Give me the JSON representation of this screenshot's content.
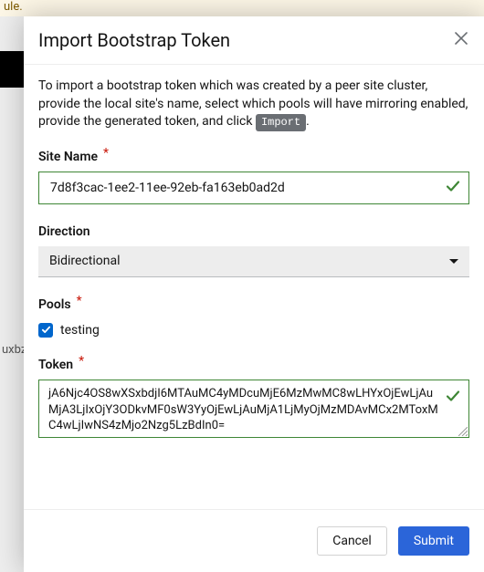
{
  "background": {
    "yellow_fragment": "ule.",
    "row_fragment": "uxbz"
  },
  "modal": {
    "title": "Import Bootstrap Token",
    "intro_pre": "To import a bootstrap token which was created by a peer site cluster, provide the local site's name, select which pools will have mirroring enabled, provide the generated token, and click ",
    "import_chip": "Import",
    "intro_post": "."
  },
  "siteName": {
    "label": "Site Name",
    "value": "7d8f3cac-1ee2-11ee-92eb-fa163eb0ad2d"
  },
  "direction": {
    "label": "Direction",
    "value": "Bidirectional"
  },
  "pools": {
    "label": "Pools",
    "items": [
      {
        "label": "testing",
        "checked": true
      }
    ]
  },
  "token": {
    "label": "Token",
    "value": "jA6Njc4OS8wXSxbdjI6MTAuMC4yMDcuMjE6MzMwMC8wLHYxOjEwLjAuMjA3LjIxOjY3ODkvMF0sW3YyOjEwLjAuMjA1LjMyOjMzMDAvMCx2MToxMC4wLjIwNS4zMjo2Nzg5LzBdIn0="
  },
  "buttons": {
    "cancel": "Cancel",
    "submit": "Submit"
  }
}
